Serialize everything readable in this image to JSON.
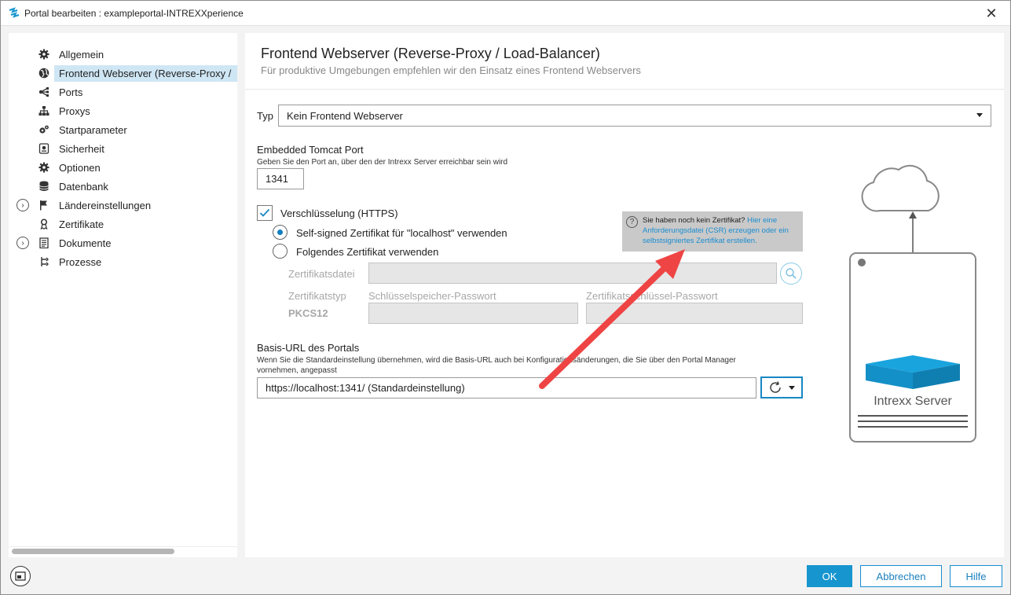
{
  "window": {
    "title": "Portal bearbeiten : exampleportal-INTREXXperience"
  },
  "sidebar": {
    "items": [
      {
        "label": "Allgemein",
        "icon": "gear-icon"
      },
      {
        "label": "Frontend Webserver (Reverse-Proxy /",
        "icon": "globe-icon",
        "selected": true
      },
      {
        "label": "Ports",
        "icon": "ports-icon"
      },
      {
        "label": "Proxys",
        "icon": "network-icon"
      },
      {
        "label": "Startparameter",
        "icon": "gears-icon"
      },
      {
        "label": "Sicherheit",
        "icon": "security-icon"
      },
      {
        "label": "Optionen",
        "icon": "gear-icon"
      },
      {
        "label": "Datenbank",
        "icon": "database-icon"
      },
      {
        "label": "Ländereinstellungen",
        "icon": "flag-icon",
        "expandable": true
      },
      {
        "label": "Zertifikate",
        "icon": "certificate-icon"
      },
      {
        "label": "Dokumente",
        "icon": "document-icon",
        "expandable": true
      },
      {
        "label": "Prozesse",
        "icon": "process-icon"
      }
    ]
  },
  "header": {
    "title": "Frontend Webserver (Reverse-Proxy / Load-Balancer)",
    "subtitle": "Für produktive Umgebungen empfehlen wir den Einsatz eines Frontend Webservers"
  },
  "form": {
    "typ_label": "Typ",
    "typ_value": "Kein Frontend Webserver",
    "tomcat_label": "Embedded Tomcat Port",
    "tomcat_help": "Geben Sie den Port an, über den der Intrexx Server erreichbar sein wird",
    "tomcat_port": "1341",
    "https_label": "Verschlüsselung (HTTPS)",
    "https_checked": true,
    "radio_selfsigned": "Self-signed Zertifikat für \"localhost\" verwenden",
    "radio_following": "Folgendes Zertifikat verwenden",
    "selected_radio": "selfsigned",
    "cert_file_label": "Zertifikatsdatei",
    "cert_type_label": "Zertifikatstyp",
    "cert_type_value": "PKCS12",
    "keystore_pw_label": "Schlüsselspeicher-Passwort",
    "cert_key_pw_label": "Zertifikatsschlüssel-Passwort",
    "base_url_label": "Basis-URL des Portals",
    "base_url_help": "Wenn Sie die Standardeinstellung übernehmen, wird die Basis-URL auch bei Konfigurationsänderungen, die Sie über den Portal Manager vornehmen, angepasst",
    "base_url_value": "https://localhost:1341/ (Standardeinstellung)"
  },
  "tooltip": {
    "text": "Sie haben noch kein Zertifikat? ",
    "link": "Hier eine Anforderungsdatei (CSR) erzeugen oder ein selbstsigniertes Zertifikat erstellen."
  },
  "diagram": {
    "server_label": "Intrexx Server"
  },
  "footer": {
    "ok_label": "OK",
    "cancel_label": "Abbrechen",
    "help_label": "Hilfe"
  },
  "colors": {
    "accent": "#1795cf",
    "selection": "#cfe6f4",
    "arrow": "#ef4444",
    "server_box": "#1aa0d9"
  }
}
